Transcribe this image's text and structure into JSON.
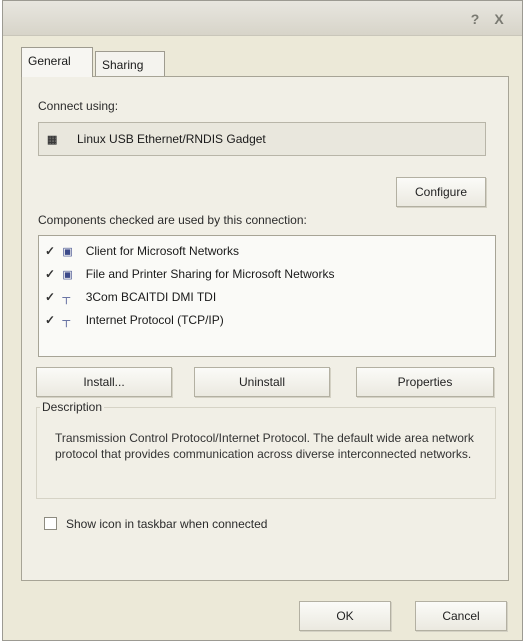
{
  "tabs": {
    "general": "General",
    "sharing": "Sharing"
  },
  "connect_using": {
    "label": "Connect using:",
    "adapter_name": "Linux USB Ethernet/RNDIS Gadget",
    "configure_label": "Configure"
  },
  "components": {
    "label": "Components checked are used by this connection:",
    "items": [
      {
        "name": "Client for Microsoft Networks",
        "checked": true,
        "icon": "network-client-icon"
      },
      {
        "name": "File and Printer Sharing for Microsoft Networks",
        "checked": true,
        "icon": "file-sharing-icon"
      },
      {
        "name": "3Com BCAITDI DMI TDI",
        "checked": true,
        "icon": "protocol-icon"
      },
      {
        "name": "Internet Protocol (TCP/IP)",
        "checked": true,
        "icon": "protocol-icon"
      }
    ],
    "install_label": "Install...",
    "uninstall_label": "Uninstall",
    "properties_label": "Properties"
  },
  "description": {
    "label": "Description",
    "text": "Transmission Control Protocol/Internet Protocol. The default wide area network protocol that provides communication across diverse interconnected networks."
  },
  "taskbar_option": {
    "label": "Show icon in taskbar when connected",
    "checked": false
  },
  "footer": {
    "ok_label": "OK",
    "cancel_label": "Cancel"
  },
  "titlebar": {
    "help_glyph": "?",
    "close_glyph": "X"
  }
}
